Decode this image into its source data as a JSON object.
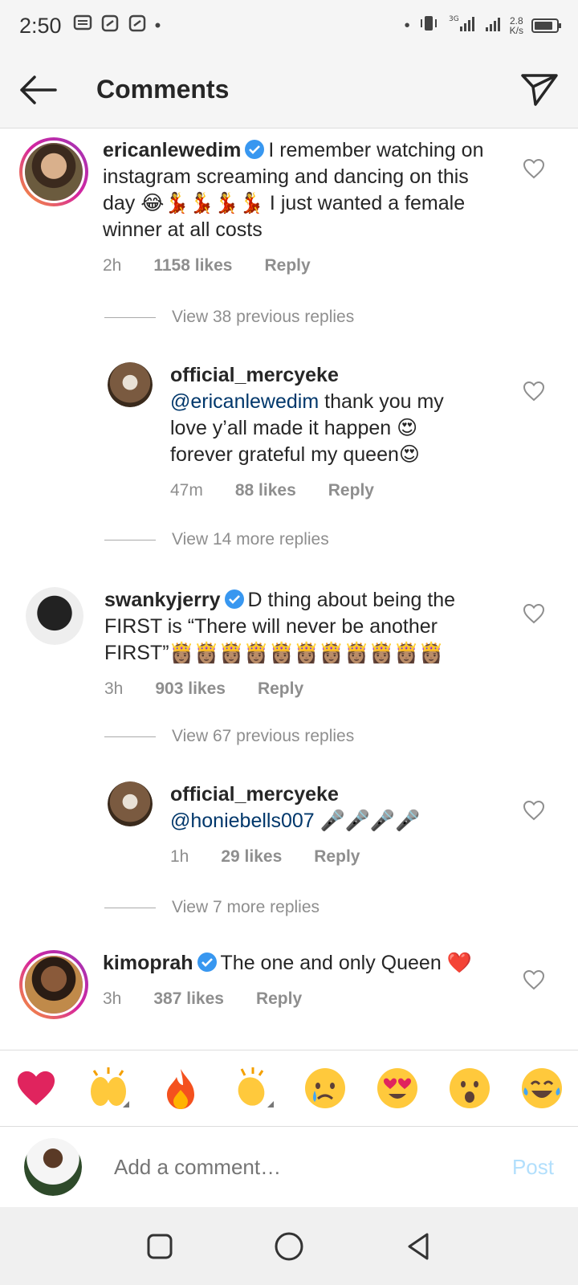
{
  "status_bar": {
    "time": "2:50",
    "network_label": "3G",
    "speed_value": "2.8",
    "speed_unit": "K/s",
    "battery_level": 0.85
  },
  "header": {
    "title": "Comments"
  },
  "comments": [
    {
      "username": "ericanlewedim",
      "verified": true,
      "text": "I remember watching on instagram screaming and dancing on this day 😂💃💃💃💃 I just wanted a female winner at all costs",
      "time": "2h",
      "likes": "1158 likes",
      "reply": "Reply"
    },
    {
      "view_replies": "View 38 previous replies"
    },
    {
      "username": "official_mercyeke",
      "mention": "@ericanlewedim",
      "text": "thank you my love y’all made it happen 😍 forever grateful my queen😍",
      "time": "47m",
      "likes": "88 likes",
      "reply": "Reply"
    },
    {
      "view_replies": "View 14 more replies"
    },
    {
      "username": "swankyjerry",
      "verified": true,
      "text": "D thing about being the FIRST is “There will never be another FIRST”👸🏽👸🏽👸🏽👸🏽👸🏽👸🏽👸🏽👸🏽👸🏽👸🏽👸🏽",
      "time": "3h",
      "likes": "903 likes",
      "reply": "Reply"
    },
    {
      "view_replies": "View 67 previous replies"
    },
    {
      "username": "official_mercyeke",
      "mention": "@honiebells007",
      "text": "🎤🎤🎤🎤",
      "time": "1h",
      "likes": "29 likes",
      "reply": "Reply"
    },
    {
      "view_replies": "View 7 more replies"
    },
    {
      "username": "kimoprah",
      "verified": true,
      "text": "The one and only Queen ❤️",
      "time": "3h",
      "likes": "387 likes",
      "reply": "Reply"
    }
  ],
  "reactions": [
    "red-heart",
    "raising-hands",
    "fire",
    "clapping-hands",
    "crying-face",
    "heart-eyes",
    "surprised-face",
    "tears-of-joy"
  ],
  "add_comment": {
    "placeholder": "Add a comment…",
    "post_label": "Post"
  },
  "colors": {
    "accent_blue": "#3897f0",
    "post_disabled": "#b2dffc",
    "meta_gray": "#8e8e8e",
    "mention_blue": "#00376b"
  }
}
